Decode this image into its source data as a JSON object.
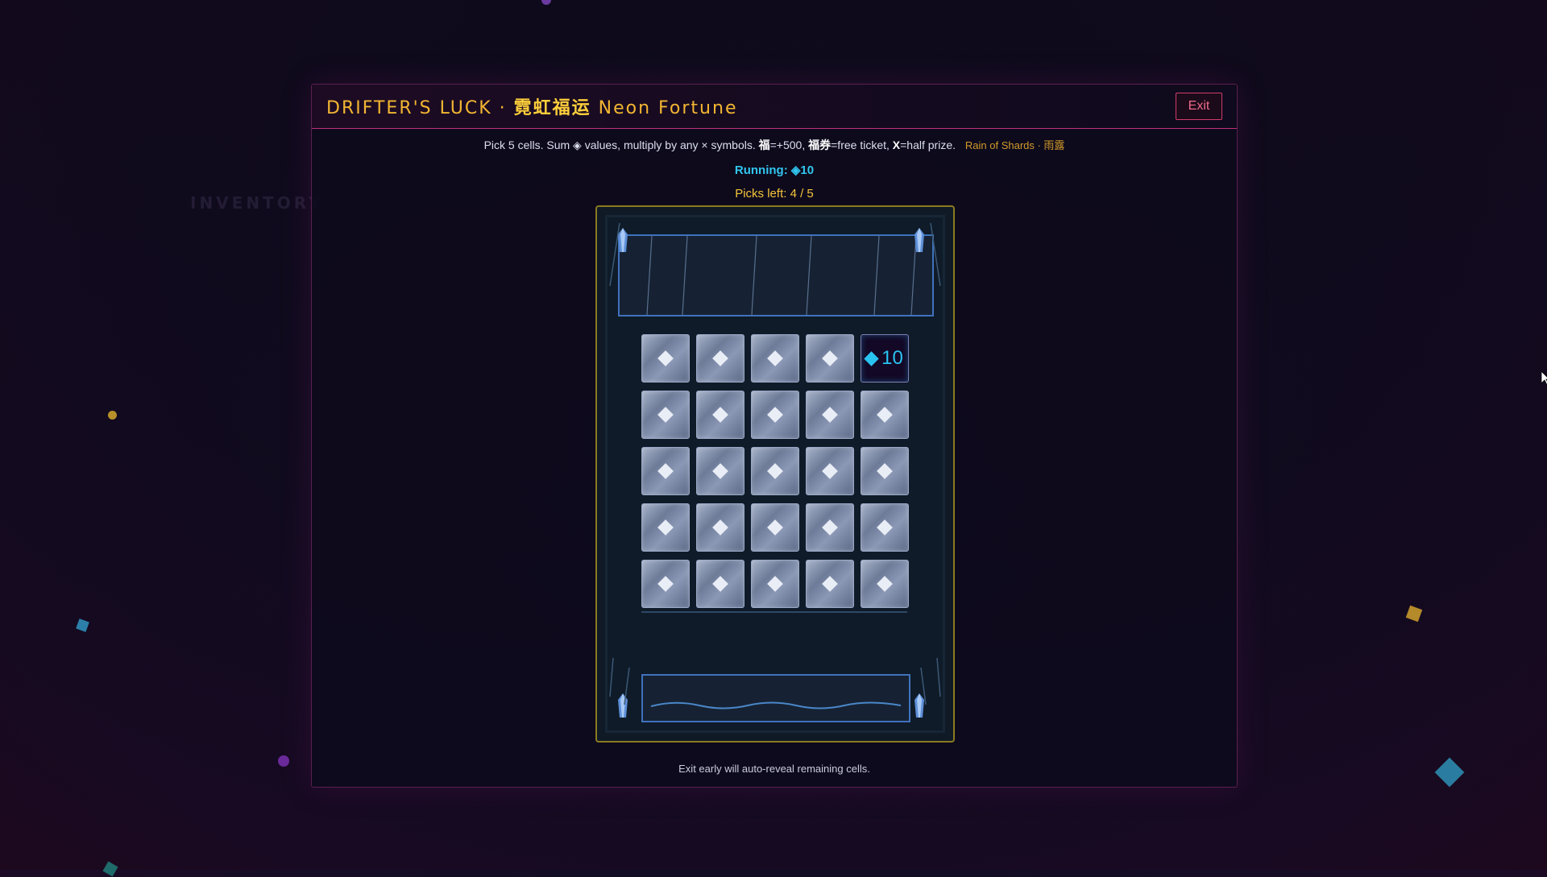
{
  "game": {
    "title_en_prefix": "DRIFTER'S LUCK · ",
    "title_cn": "霓虹福运",
    "title_en_suffix": " Neon Fortune",
    "exit_label": "Exit"
  },
  "rules": {
    "text_1": "Pick 5 cells. Sum ◈ values, multiply by any × symbols. ",
    "fu_symbol": "福",
    "text_2": "=+500, ",
    "fuquan_symbol": "福券",
    "text_3": "=free ticket, ",
    "x_symbol": "X",
    "text_4": "=half prize.",
    "event": "Rain of Shards · 雨露"
  },
  "status": {
    "running": "Running: ◈10",
    "picks": "Picks left: 4 / 5"
  },
  "grid": {
    "rows": 5,
    "cols": 5,
    "cells": [
      {
        "state": "hidden"
      },
      {
        "state": "hidden"
      },
      {
        "state": "hidden"
      },
      {
        "state": "hidden"
      },
      {
        "state": "revealed",
        "value": "10"
      },
      {
        "state": "hidden"
      },
      {
        "state": "hidden"
      },
      {
        "state": "hidden"
      },
      {
        "state": "hidden"
      },
      {
        "state": "hidden"
      },
      {
        "state": "hidden"
      },
      {
        "state": "hidden"
      },
      {
        "state": "hidden"
      },
      {
        "state": "hidden"
      },
      {
        "state": "hidden"
      },
      {
        "state": "hidden"
      },
      {
        "state": "hidden"
      },
      {
        "state": "hidden"
      },
      {
        "state": "hidden"
      },
      {
        "state": "hidden"
      },
      {
        "state": "hidden"
      },
      {
        "state": "hidden"
      },
      {
        "state": "hidden"
      },
      {
        "state": "hidden"
      },
      {
        "state": "hidden"
      }
    ]
  },
  "footer_note": "Exit early will auto-reveal remaining cells.",
  "background": {
    "ghost_label": "INVENTORY"
  },
  "colors": {
    "accent_gold": "#f3b632",
    "accent_cyan": "#29c3f0",
    "accent_pink": "#d03c6a",
    "panel_blue": "#3f72bd"
  }
}
